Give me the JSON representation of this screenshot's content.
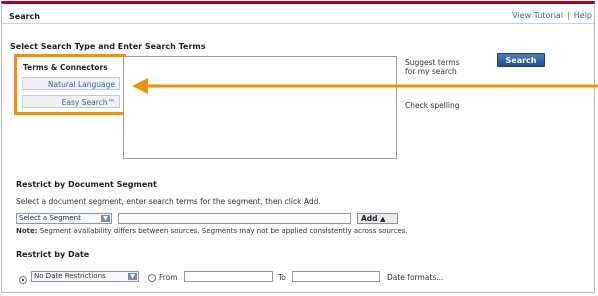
{
  "header": {
    "title": "Search",
    "links": [
      "View Tutorial",
      "Help"
    ],
    "separator": "|"
  },
  "search_type": {
    "heading": "Select Search Type and Enter Search Terms",
    "options": [
      {
        "label": "Terms & Connectors",
        "active": true
      },
      {
        "label": "Natural Language",
        "active": false
      },
      {
        "label": "Easy Search™",
        "active": false
      }
    ],
    "search_terms_value": ""
  },
  "side_links": {
    "suggest": "Suggest terms\nfor my search",
    "suggest_line1": "Suggest terms",
    "suggest_line2": "for my search",
    "spelling": "Check spelling"
  },
  "search_button": "Search",
  "segment": {
    "heading": "Restrict by Document Segment",
    "instruction": "Select a document segment, enter search terms for the segment, then click Add.",
    "select_value": "Select a Segment",
    "input_value": "",
    "add_label": "Add",
    "note_label": "Note:",
    "note_text": " Segment availability differs between sources. Segments may not be applied consistently across sources."
  },
  "date": {
    "heading": "Restrict by Date",
    "select_value": "No Date Restrictions",
    "from_label": "From",
    "from_value": "",
    "to_label": "To",
    "to_value": "",
    "formats_link": "Date formats..."
  },
  "colors": {
    "accent": "#a8001d",
    "highlight": "#f39200",
    "link": "#3366aa",
    "button": "#2a5c9c"
  }
}
